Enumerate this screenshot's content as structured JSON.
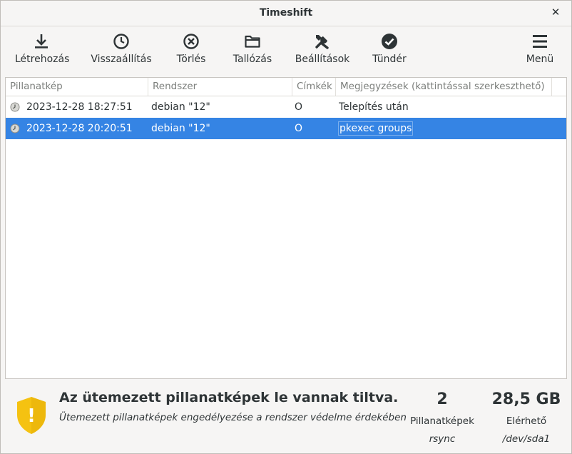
{
  "window": {
    "title": "Timeshift",
    "close_glyph": "✕"
  },
  "toolbar": {
    "items": [
      {
        "label": "Létrehozás",
        "icon": "download-icon"
      },
      {
        "label": "Visszaállítás",
        "icon": "clock-icon"
      },
      {
        "label": "Törlés",
        "icon": "delete-circle-icon"
      },
      {
        "label": "Tallózás",
        "icon": "folder-icon"
      },
      {
        "label": "Beállítások",
        "icon": "tools-icon"
      },
      {
        "label": "Tündér",
        "icon": "check-circle-icon"
      },
      {
        "label": "Menü",
        "icon": "hamburger-menu-icon"
      }
    ]
  },
  "table": {
    "columns": [
      "Pillanatkép",
      "Rendszer",
      "Címkék",
      "Megjegyzések (kattintással szerkeszthető)"
    ],
    "rows": [
      {
        "snapshot": "2023-12-28 18:27:51",
        "system": "debian \"12\"",
        "tags": "O",
        "notes": "Telepítés után",
        "selected": false
      },
      {
        "snapshot": "2023-12-28 20:20:51",
        "system": "debian \"12\"",
        "tags": "O",
        "notes": "pkexec groups",
        "selected": true
      }
    ]
  },
  "status": {
    "title": "Az ütemezett pillanatképek le vannak tiltva.",
    "subtitle": "Ütemezett pillanatképek engedélyezése a rendszer védelme érdekében",
    "shield_glyph": "!",
    "snapshots_count": "2",
    "snapshots_label": "Pillanatképek",
    "snapshots_sub": "rsync",
    "available_size": "28,5 GB",
    "available_label": "Elérhető",
    "available_sub": "/dev/sda1"
  },
  "colors": {
    "selection": "#3584e4",
    "warning": "#f5c211"
  }
}
